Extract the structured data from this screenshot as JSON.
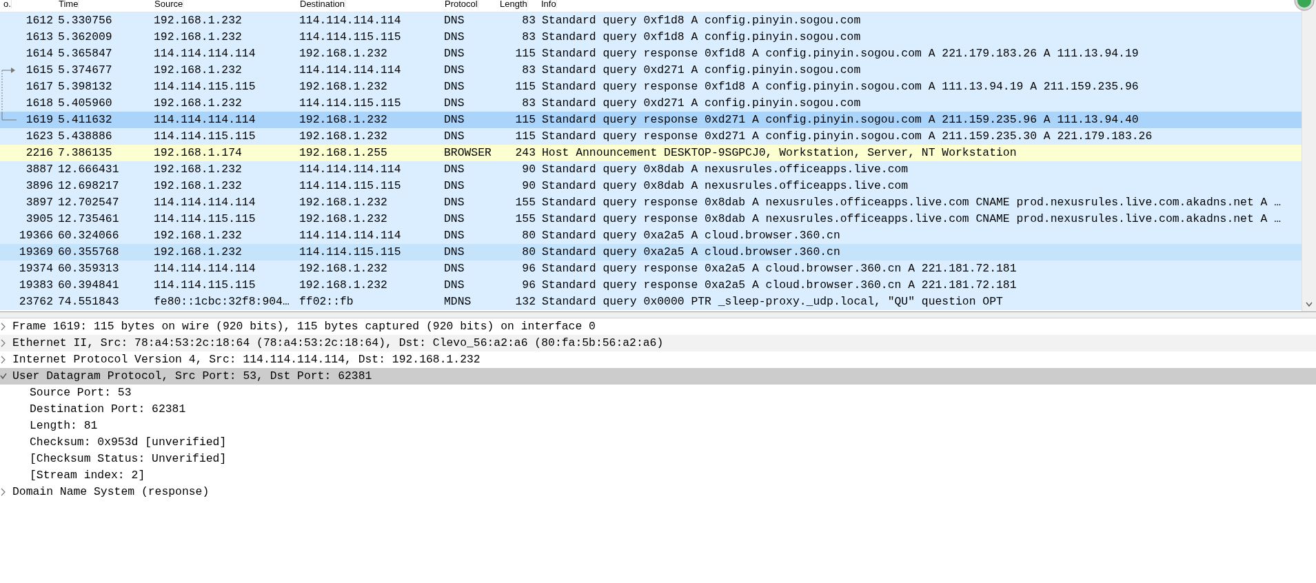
{
  "packet_list": {
    "columns": [
      "o.",
      "Time",
      "Source",
      "Destination",
      "Protocol",
      "Length",
      "Info"
    ],
    "rows": [
      {
        "no": "1612",
        "time": "5.330756",
        "source": "192.168.1.232",
        "destination": "114.114.114.114",
        "protocol": "DNS",
        "length": "83",
        "info": "Standard query 0xf1d8 A config.pinyin.sogou.com",
        "color": "#daeeff",
        "selected": false,
        "hovered": false
      },
      {
        "no": "1613",
        "time": "5.362009",
        "source": "192.168.1.232",
        "destination": "114.114.115.115",
        "protocol": "DNS",
        "length": "83",
        "info": "Standard query 0xf1d8 A config.pinyin.sogou.com",
        "color": "#daeeff",
        "selected": false,
        "hovered": false
      },
      {
        "no": "1614",
        "time": "5.365847",
        "source": "114.114.114.114",
        "destination": "192.168.1.232",
        "protocol": "DNS",
        "length": "115",
        "info": "Standard query response 0xf1d8 A config.pinyin.sogou.com A 221.179.183.26 A 111.13.94.19",
        "color": "#daeeff",
        "selected": false,
        "hovered": false
      },
      {
        "no": "1615",
        "time": "5.374677",
        "source": "192.168.1.232",
        "destination": "114.114.114.114",
        "protocol": "DNS",
        "length": "83",
        "info": "Standard query 0xd271 A config.pinyin.sogou.com",
        "color": "#daeeff",
        "selected": false,
        "hovered": false,
        "kind": "request"
      },
      {
        "no": "1617",
        "time": "5.398132",
        "source": "114.114.115.115",
        "destination": "192.168.1.232",
        "protocol": "DNS",
        "length": "115",
        "info": "Standard query response 0xf1d8 A config.pinyin.sogou.com A 111.13.94.19 A 211.159.235.96",
        "color": "#daeeff",
        "selected": false,
        "hovered": false,
        "kind": "span"
      },
      {
        "no": "1618",
        "time": "5.405960",
        "source": "192.168.1.232",
        "destination": "114.114.115.115",
        "protocol": "DNS",
        "length": "83",
        "info": "Standard query 0xd271 A config.pinyin.sogou.com",
        "color": "#daeeff",
        "selected": false,
        "hovered": false,
        "kind": "span"
      },
      {
        "no": "1619",
        "time": "5.411632",
        "source": "114.114.114.114",
        "destination": "192.168.1.232",
        "protocol": "DNS",
        "length": "115",
        "info": "Standard query response 0xd271 A config.pinyin.sogou.com A 211.159.235.96 A 111.13.94.40",
        "selected": true,
        "hovered": false,
        "kind": "current"
      },
      {
        "no": "1623",
        "time": "5.438886",
        "source": "114.114.115.115",
        "destination": "192.168.1.232",
        "protocol": "DNS",
        "length": "115",
        "info": "Standard query response 0xd271 A config.pinyin.sogou.com A 211.159.235.30 A 221.179.183.26",
        "color": "#daeeff",
        "selected": false,
        "hovered": false
      },
      {
        "no": "2216",
        "time": "7.386135",
        "source": "192.168.1.174",
        "destination": "192.168.1.255",
        "protocol": "BROWSER",
        "length": "243",
        "info": "Host Announcement DESKTOP-9SGPCJ0, Workstation, Server, NT Workstation",
        "color": "#feffd0",
        "selected": false,
        "hovered": false
      },
      {
        "no": "3887",
        "time": "12.666431",
        "source": "192.168.1.232",
        "destination": "114.114.114.114",
        "protocol": "DNS",
        "length": "90",
        "info": "Standard query 0x8dab A nexusrules.officeapps.live.com",
        "color": "#daeeff",
        "selected": false,
        "hovered": false
      },
      {
        "no": "3896",
        "time": "12.698217",
        "source": "192.168.1.232",
        "destination": "114.114.115.115",
        "protocol": "DNS",
        "length": "90",
        "info": "Standard query 0x8dab A nexusrules.officeapps.live.com",
        "color": "#daeeff",
        "selected": false,
        "hovered": false
      },
      {
        "no": "3897",
        "time": "12.702547",
        "source": "114.114.114.114",
        "destination": "192.168.1.232",
        "protocol": "DNS",
        "length": "155",
        "info": "Standard query response 0x8dab A nexusrules.officeapps.live.com CNAME prod.nexusrules.live.com.akadns.net A …",
        "color": "#daeeff",
        "selected": false,
        "hovered": false
      },
      {
        "no": "3905",
        "time": "12.735461",
        "source": "114.114.115.115",
        "destination": "192.168.1.232",
        "protocol": "DNS",
        "length": "155",
        "info": "Standard query response 0x8dab A nexusrules.officeapps.live.com CNAME prod.nexusrules.live.com.akadns.net A …",
        "color": "#daeeff",
        "selected": false,
        "hovered": false
      },
      {
        "no": "19366",
        "time": "60.324066",
        "source": "192.168.1.232",
        "destination": "114.114.114.114",
        "protocol": "DNS",
        "length": "80",
        "info": "Standard query 0xa2a5 A cloud.browser.360.cn",
        "color": "#daeeff",
        "selected": false,
        "hovered": false
      },
      {
        "no": "19369",
        "time": "60.355768",
        "source": "192.168.1.232",
        "destination": "114.114.115.115",
        "protocol": "DNS",
        "length": "80",
        "info": "Standard query 0xa2a5 A cloud.browser.360.cn",
        "selected": false,
        "hovered": true
      },
      {
        "no": "19374",
        "time": "60.359313",
        "source": "114.114.114.114",
        "destination": "192.168.1.232",
        "protocol": "DNS",
        "length": "96",
        "info": "Standard query response 0xa2a5 A cloud.browser.360.cn A 221.181.72.181",
        "color": "#daeeff",
        "selected": false,
        "hovered": false
      },
      {
        "no": "19383",
        "time": "60.394841",
        "source": "114.114.115.115",
        "destination": "192.168.1.232",
        "protocol": "DNS",
        "length": "96",
        "info": "Standard query response 0xa2a5 A cloud.browser.360.cn A 221.181.72.181",
        "color": "#daeeff",
        "selected": false,
        "hovered": false
      },
      {
        "no": "23762",
        "time": "74.551843",
        "source": "fe80::1cbc:32f8:904…",
        "destination": "ff02::fb",
        "protocol": "MDNS",
        "length": "132",
        "info": "Standard query 0x0000 PTR _sleep-proxy._udp.local, \"QU\" question OPT",
        "color": "#daeeff",
        "selected": false,
        "hovered": false
      }
    ]
  },
  "details": [
    {
      "text": "Frame 1619: 115 bytes on wire (920 bits), 115 bytes captured (920 bits) on interface 0",
      "expanded": false,
      "selected": false
    },
    {
      "text": "Ethernet II, Src: 78:a4:53:2c:18:64 (78:a4:53:2c:18:64), Dst: Clevo_56:a2:a6 (80:fa:5b:56:a2:a6)",
      "expanded": false,
      "selected": false
    },
    {
      "text": "Internet Protocol Version 4, Src: 114.114.114.114, Dst: 192.168.1.232",
      "expanded": false,
      "selected": false
    },
    {
      "text": "User Datagram Protocol, Src Port: 53, Dst Port: 62381",
      "expanded": true,
      "selected": true,
      "children": [
        {
          "text": "Source Port: 53"
        },
        {
          "text": "Destination Port: 62381"
        },
        {
          "text": "Length: 81"
        },
        {
          "text": "Checksum: 0x953d [unverified]"
        },
        {
          "text": "[Checksum Status: Unverified]"
        },
        {
          "text": "[Stream index: 2]"
        }
      ]
    },
    {
      "text": "Domain Name System (response)",
      "expanded": false,
      "selected": false
    }
  ]
}
